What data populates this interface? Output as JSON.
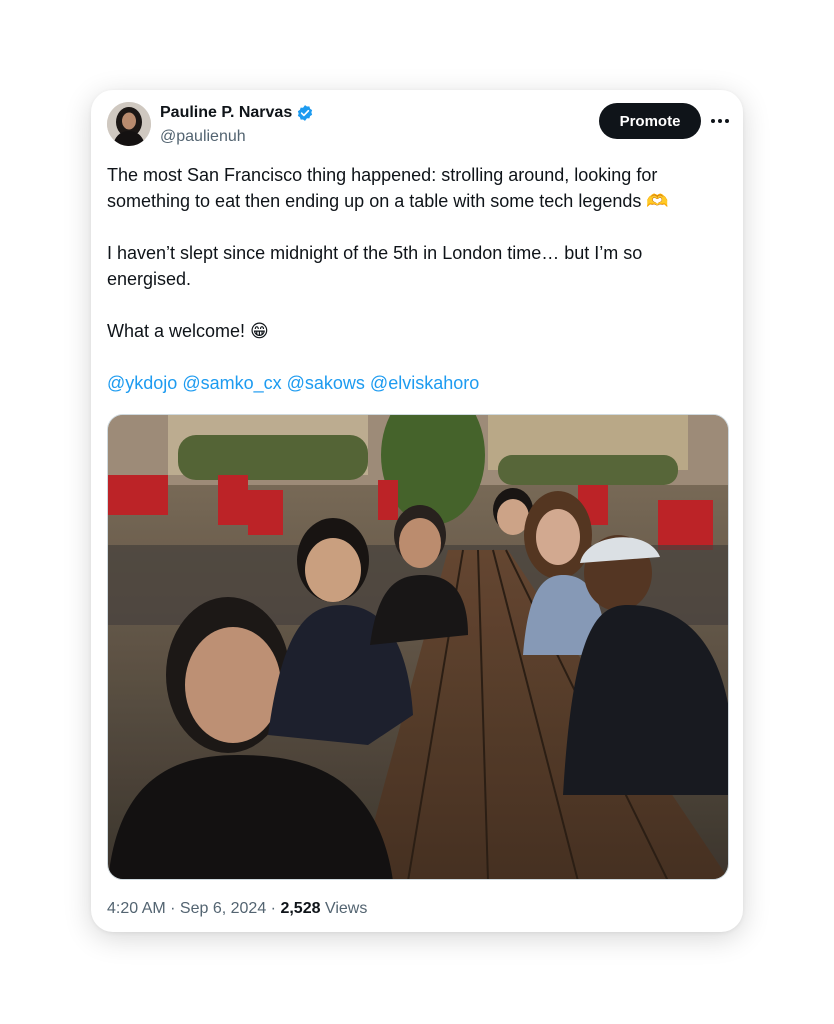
{
  "tweet": {
    "author": {
      "display_name": "Pauline P. Narvas",
      "handle": "@paulienuh",
      "verified_color": "#1d9bf0"
    },
    "promote_label": "Promote",
    "more_icon": "more-horizontal-icon",
    "paragraphs": [
      "The most San Francisco thing happened: strolling around, looking for something to eat then ending up on a table with some tech legends 🫶",
      "I haven’t slept since midnight of the 5th in London time… but I’m so energised.",
      "What a welcome! 😁"
    ],
    "mentions": [
      "@ykdojo",
      "@samko_cx",
      "@sakows",
      "@elviskahoro"
    ],
    "timestamp": "4:20 AM · Sep 6, 2024",
    "separator": "·",
    "views_count": "2,528",
    "views_label": "Views"
  },
  "colors": {
    "text": "#0f1419",
    "secondary": "#536471",
    "link": "#1d9bf0",
    "button_bg": "#0f1419"
  }
}
